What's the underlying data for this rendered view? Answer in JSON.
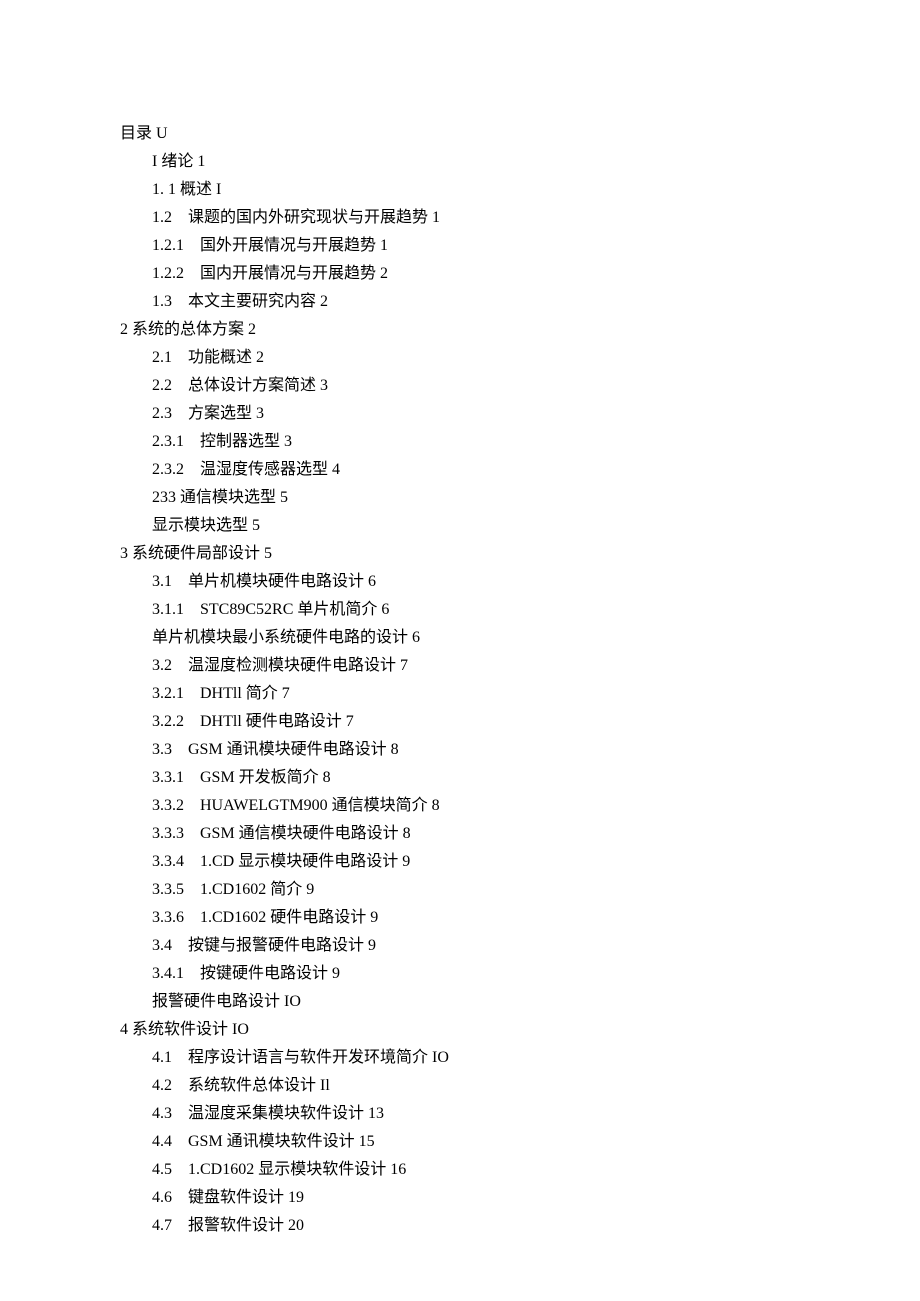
{
  "toc": [
    {
      "indent": 0,
      "text": "目录 U"
    },
    {
      "indent": 1,
      "text": "I 绪论 1"
    },
    {
      "indent": 1,
      "text": "1. 1 概述 I"
    },
    {
      "indent": 1,
      "text": "1.2　课题的国内外研究现状与开展趋势 1"
    },
    {
      "indent": 1,
      "text": "1.2.1　国外开展情况与开展趋势 1"
    },
    {
      "indent": 1,
      "text": "1.2.2　国内开展情况与开展趋势 2"
    },
    {
      "indent": 1,
      "text": "1.3　本文主要研究内容 2"
    },
    {
      "indent": 0,
      "text": "2 系统的总体方案 2"
    },
    {
      "indent": 1,
      "text": "2.1　功能概述 2"
    },
    {
      "indent": 1,
      "text": "2.2　总体设计方案简述 3"
    },
    {
      "indent": 1,
      "text": "2.3　方案选型 3"
    },
    {
      "indent": 1,
      "text": "2.3.1　控制器选型 3"
    },
    {
      "indent": 1,
      "text": "2.3.2　温湿度传感器选型 4"
    },
    {
      "indent": 1,
      "text": "233 通信模块选型 5"
    },
    {
      "indent": 1,
      "text": "显示模块选型 5"
    },
    {
      "indent": 0,
      "text": "3 系统硬件局部设计 5"
    },
    {
      "indent": 1,
      "text": "3.1　单片机模块硬件电路设计 6"
    },
    {
      "indent": 1,
      "text": "3.1.1　STC89C52RC 单片机简介 6"
    },
    {
      "indent": 1,
      "text": "单片机模块最小系统硬件电路的设计 6"
    },
    {
      "indent": 1,
      "text": "3.2　温湿度检测模块硬件电路设计 7"
    },
    {
      "indent": 1,
      "text": "3.2.1　DHTll 简介 7"
    },
    {
      "indent": 1,
      "text": "3.2.2　DHTll 硬件电路设计 7"
    },
    {
      "indent": 1,
      "text": "3.3　GSM 通讯模块硬件电路设计 8"
    },
    {
      "indent": 1,
      "text": "3.3.1　GSM 开发板简介 8"
    },
    {
      "indent": 1,
      "text": "3.3.2　HUAWELGTM900 通信模块简介 8"
    },
    {
      "indent": 1,
      "text": "3.3.3　GSM 通信模块硬件电路设计 8"
    },
    {
      "indent": 1,
      "text": "3.3.4　1.CD 显示模块硬件电路设计 9"
    },
    {
      "indent": 1,
      "text": "3.3.5　1.CD1602 简介 9"
    },
    {
      "indent": 1,
      "text": "3.3.6　1.CD1602 硬件电路设计 9"
    },
    {
      "indent": 1,
      "text": "3.4　按键与报警硬件电路设计 9"
    },
    {
      "indent": 1,
      "text": "3.4.1　按键硬件电路设计 9"
    },
    {
      "indent": 1,
      "text": "报警硬件电路设计 IO"
    },
    {
      "indent": 0,
      "text": "4 系统软件设计 IO"
    },
    {
      "indent": 1,
      "text": "4.1　程序设计语言与软件开发环境简介 IO"
    },
    {
      "indent": 1,
      "text": "4.2　系统软件总体设计 Il"
    },
    {
      "indent": 1,
      "text": "4.3　温湿度采集模块软件设计 13"
    },
    {
      "indent": 1,
      "text": "4.4　GSM 通讯模块软件设计 15"
    },
    {
      "indent": 1,
      "text": "4.5　1.CD1602 显示模块软件设计 16"
    },
    {
      "indent": 1,
      "text": "4.6　键盘软件设计 19"
    },
    {
      "indent": 1,
      "text": "4.7　报警软件设计 20"
    }
  ]
}
